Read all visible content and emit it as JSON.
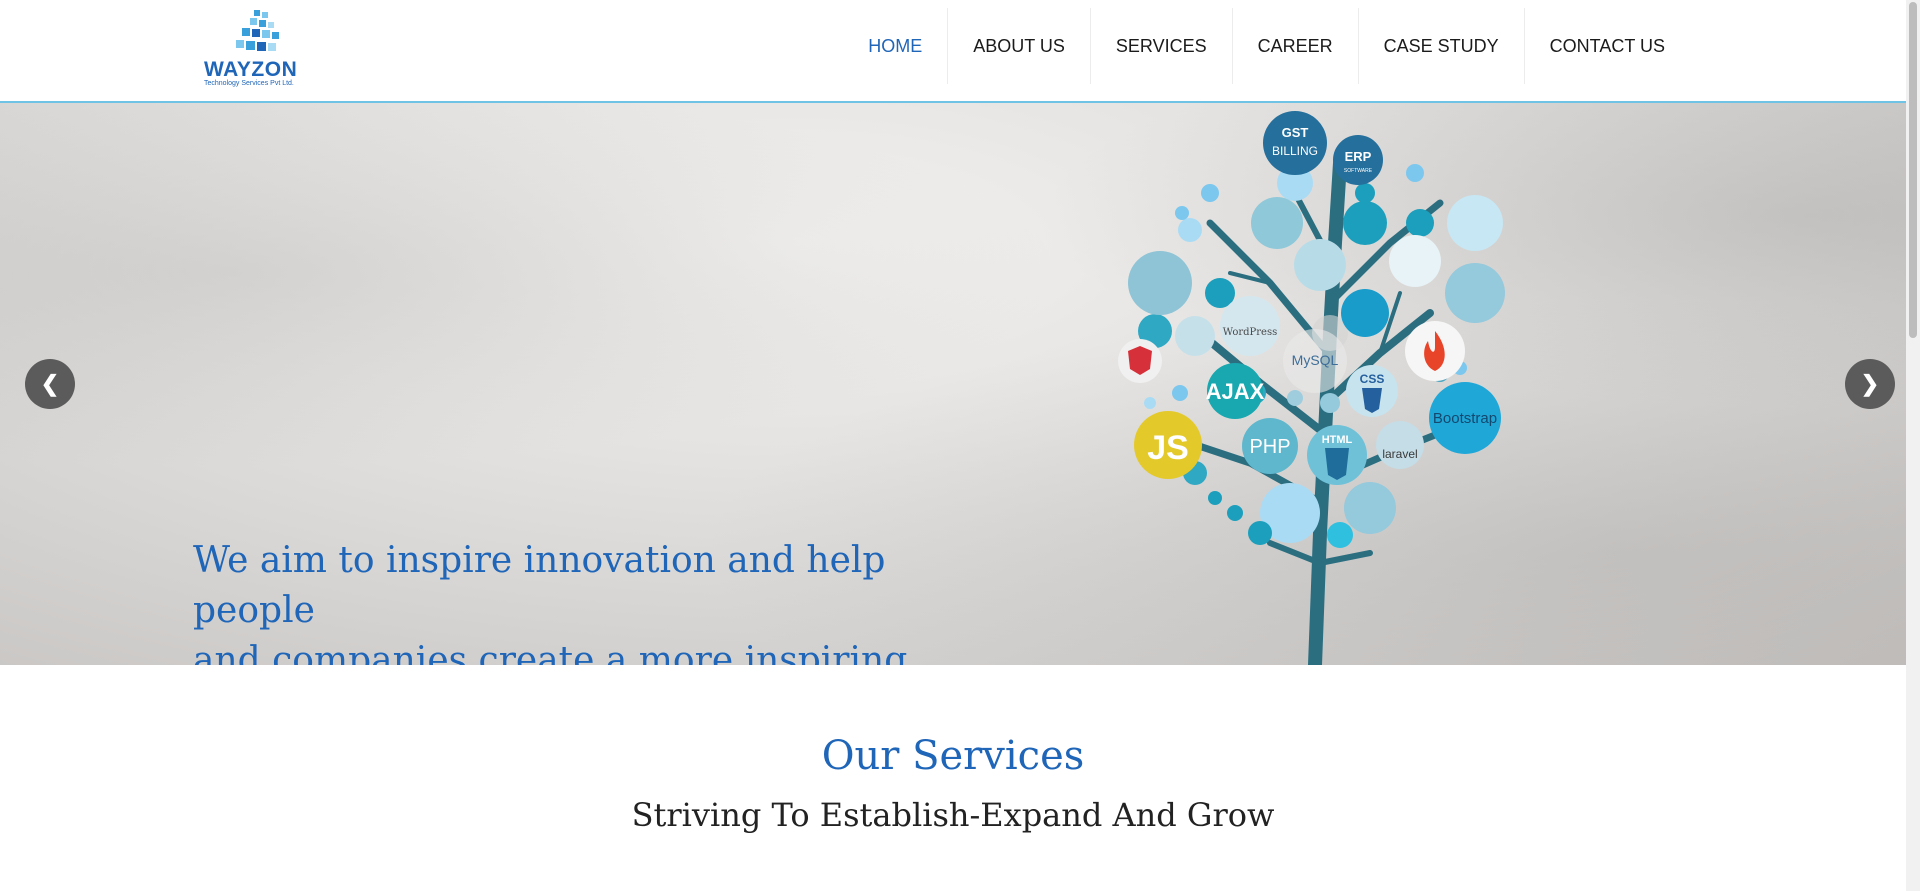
{
  "logo": {
    "name": "WAYZON",
    "tagline": "Technology Services Pvt Ltd."
  },
  "nav": [
    {
      "label": "HOME",
      "active": true
    },
    {
      "label": "ABOUT US",
      "active": false
    },
    {
      "label": "SERVICES",
      "active": false
    },
    {
      "label": "CAREER",
      "active": false
    },
    {
      "label": "CASE STUDY",
      "active": false
    },
    {
      "label": "CONTACT US",
      "active": false
    }
  ],
  "hero": {
    "tagline_line1": "We aim to inspire innovation and help people",
    "tagline_line2": "and companies create a more inspiring world",
    "prev_icon": "chevron-left-icon",
    "next_icon": "chevron-right-icon",
    "tree_labels": {
      "gst": "GST",
      "billing": "BILLING",
      "erp": "ERP",
      "erp_sub": "SOFTWARE",
      "wordpress": "WordPress",
      "mysql": "MySQL",
      "ajax": "AJAX",
      "css": "CSS",
      "php": "PHP",
      "html": "HTML",
      "bootstrap": "Bootstrap",
      "laravel": "laravel",
      "js": "JS"
    }
  },
  "services": {
    "title": "Our Services",
    "subtitle": "Striving To Establish-Expand And Grow"
  },
  "colors": {
    "accent": "#1f65b8",
    "header_border": "#6fc3e4",
    "tree_trunk": "#2b6e80"
  }
}
